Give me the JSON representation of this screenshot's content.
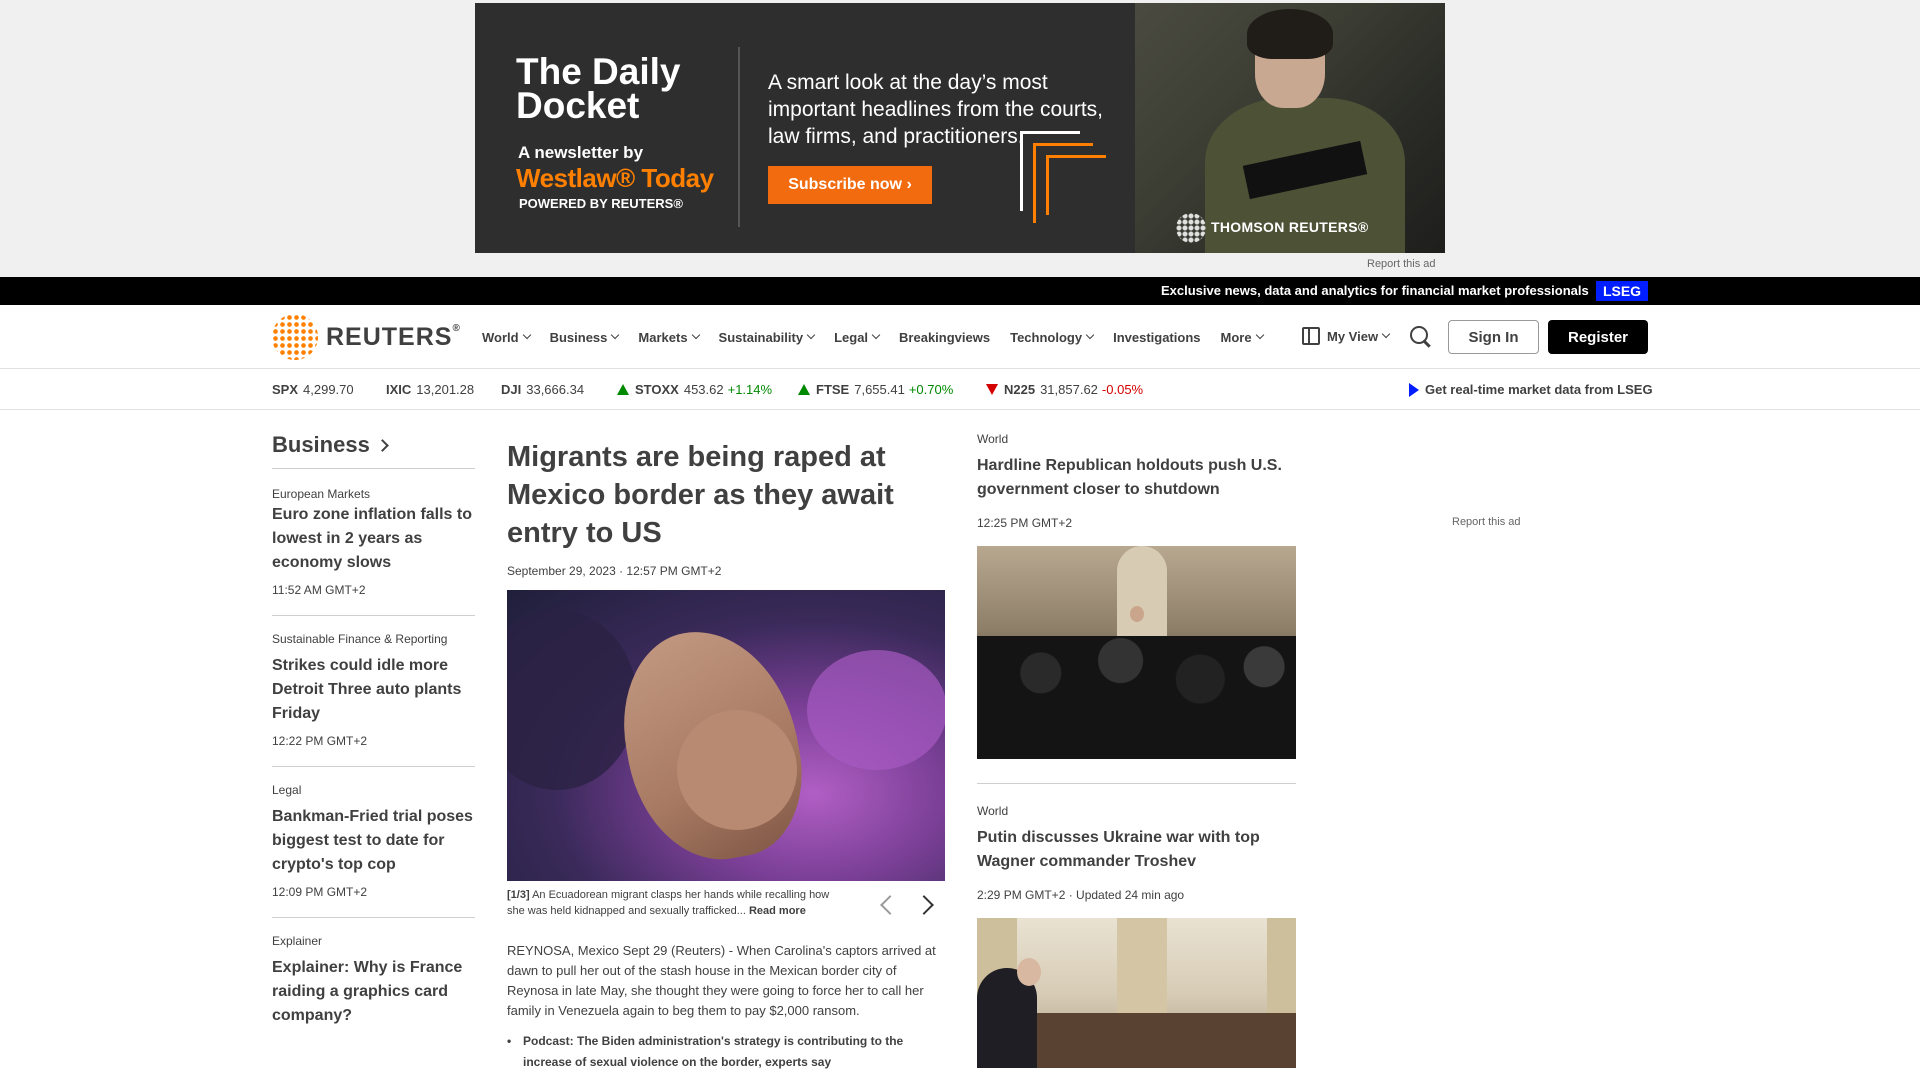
{
  "ad": {
    "title": "The Daily Docket",
    "newsletter_by": "A newsletter by",
    "westlaw": "Westlaw® Today",
    "powered": "POWERED BY REUTERS®",
    "blurb": "A smart look at the day’s most important headlines from the courts, law firms, and practitioners.",
    "cta": "Subscribe now ›",
    "advertiser": "THOMSON REUTERS®",
    "report": "Report this ad",
    "accent_color": "#f26b0f"
  },
  "promo": {
    "text": "Exclusive news, data and analytics for financial market professionals",
    "badge": "LSEG",
    "badge_color": "#001eff"
  },
  "header": {
    "logo_text": "REUTERS",
    "logo_reg": "®",
    "nav": [
      {
        "label": "World",
        "dropdown": true
      },
      {
        "label": "Business",
        "dropdown": true
      },
      {
        "label": "Markets",
        "dropdown": true
      },
      {
        "label": "Sustainability",
        "dropdown": true
      },
      {
        "label": "Legal",
        "dropdown": true
      },
      {
        "label": "Breakingviews",
        "dropdown": false
      },
      {
        "label": "Technology",
        "dropdown": true
      },
      {
        "label": "Investigations",
        "dropdown": false
      },
      {
        "label": "More",
        "dropdown": true
      }
    ],
    "my_view": "My View",
    "sign_in": "Sign In",
    "register": "Register"
  },
  "ticker": {
    "items": [
      {
        "symbol": "SPX",
        "value": "4,299.70",
        "change": "",
        "dir": ""
      },
      {
        "symbol": "IXIC",
        "value": "13,201.28",
        "change": "",
        "dir": ""
      },
      {
        "symbol": "DJI",
        "value": "33,666.34",
        "change": "",
        "dir": ""
      },
      {
        "symbol": "STOXX",
        "value": "453.62",
        "change": "+1.14%",
        "dir": "up"
      },
      {
        "symbol": "FTSE",
        "value": "7,655.41",
        "change": "+0.70%",
        "dir": "up"
      },
      {
        "symbol": "N225",
        "value": "31,857.62",
        "change": "-0.05%",
        "dir": "down"
      }
    ],
    "lseg_link": "Get real-time market data from LSEG"
  },
  "left": {
    "section": "Business",
    "stories": [
      {
        "kicker": "European Markets",
        "headline": "Euro zone inflation falls to lowest in 2 years as economy slows",
        "time": "11:52 AM GMT+2"
      },
      {
        "kicker": "Sustainable Finance & Reporting",
        "headline": "Strikes could idle more Detroit Three auto plants Friday",
        "time": "12:22 PM GMT+2"
      },
      {
        "kicker": "Legal",
        "headline": "Bankman-Fried trial poses biggest test to date for crypto's top cop",
        "time": "12:09 PM GMT+2"
      },
      {
        "kicker": "Explainer",
        "headline": "Explainer: Why is France raiding a graphics card company?",
        "time": ""
      }
    ]
  },
  "main": {
    "headline": "Migrants are being raped at Mexico border as they await entry to US",
    "date": "September 29, 2023 · 12:57 PM GMT+2",
    "caption_counter": "[1/3]",
    "caption": "An Ecuadorean migrant clasps her hands while recalling how she was held kidnapped and sexually trafficked...",
    "read_more": "Read more",
    "body": "REYNOSA, Mexico Sept 29 (Reuters) - When Carolina's captors arrived at dawn to pull her out of the stash house in the Mexican border city of Reynosa in late May, she thought they were going to force her to call her family in Venezuela again to beg them to pay $2,000 ransom.",
    "bullet": "Podcast: The Biden administration's strategy is contributing to the increase of sexual violence on the border, experts say"
  },
  "right": {
    "stories": [
      {
        "kicker": "World",
        "headline": "Hardline Republican holdouts push U.S. government closer to shutdown",
        "time": "12:25 PM GMT+2"
      },
      {
        "kicker": "World",
        "headline": "Putin discusses Ukraine war with top Wagner commander Troshev",
        "time": "2:29 PM GMT+2 · Updated 24 min ago"
      }
    ],
    "report": "Report this ad"
  }
}
